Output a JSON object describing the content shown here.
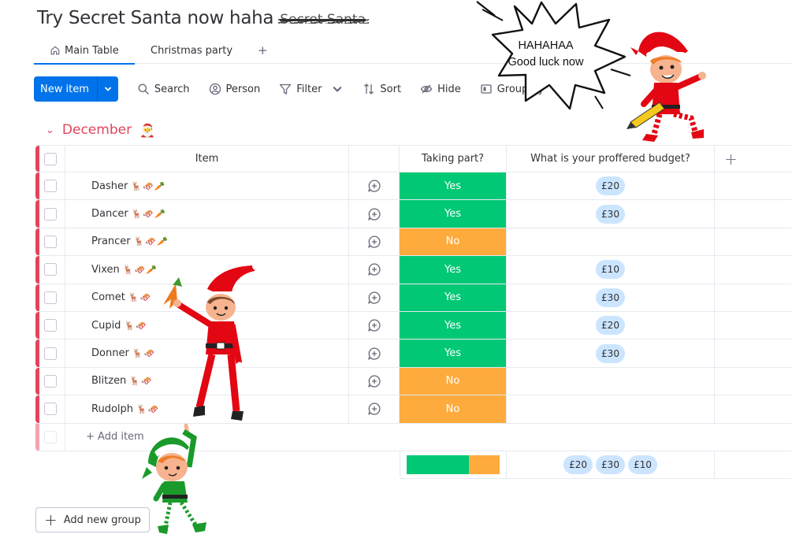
{
  "board": {
    "title": "Try Secret Santa now haha",
    "struck_title": "Secret Santa"
  },
  "tabs": [
    {
      "label": "Main Table",
      "icon": "home-icon",
      "active": true
    },
    {
      "label": "Christmas party",
      "active": false
    }
  ],
  "tab_add_label": "+",
  "toolbar": {
    "new_item_label": "New item",
    "search_label": "Search",
    "person_label": "Person",
    "filter_label": "Filter",
    "sort_label": "Sort",
    "hide_label": "Hide",
    "group_by_label": "Group by"
  },
  "speech_bubble": {
    "line1": "HAHAHAA",
    "line2": "Good luck now"
  },
  "group": {
    "title": "December",
    "emoji": "🎅",
    "color": "#e2445c",
    "columns": {
      "item": "Item",
      "status": "Taking part?",
      "budget": "What is your proffered budget?",
      "add_column": "+"
    },
    "rows": [
      {
        "name": "Dasher",
        "emoji": "🦌🛷🥕",
        "status": "Yes",
        "budget": "£20"
      },
      {
        "name": "Dancer",
        "emoji": "🦌🛷🥕",
        "status": "Yes",
        "budget": "£30"
      },
      {
        "name": "Prancer",
        "emoji": "🦌🛷🥕",
        "status": "No",
        "budget": ""
      },
      {
        "name": "Vixen",
        "emoji": "🦌🛷🥕",
        "status": "Yes",
        "budget": "£10"
      },
      {
        "name": "Comet",
        "emoji": "🦌🛷",
        "status": "Yes",
        "budget": "£30"
      },
      {
        "name": "Cupid",
        "emoji": "🦌🛷",
        "status": "Yes",
        "budget": "£20"
      },
      {
        "name": "Donner",
        "emoji": "🦌🛷",
        "status": "Yes",
        "budget": "£30"
      },
      {
        "name": "Blitzen",
        "emoji": "🦌🛷",
        "status": "No",
        "budget": ""
      },
      {
        "name": "Rudolph",
        "emoji": "🦌🛷",
        "status": "No",
        "budget": ""
      }
    ],
    "add_item_label": "+ Add item",
    "summary": {
      "status_yes_fraction": 0.667,
      "status_no_fraction": 0.333,
      "budget_values": [
        "£20",
        "£30",
        "£10"
      ]
    }
  },
  "status_colors": {
    "Yes": "#00c875",
    "No": "#fdab3d"
  },
  "add_group_label": "Add new group"
}
